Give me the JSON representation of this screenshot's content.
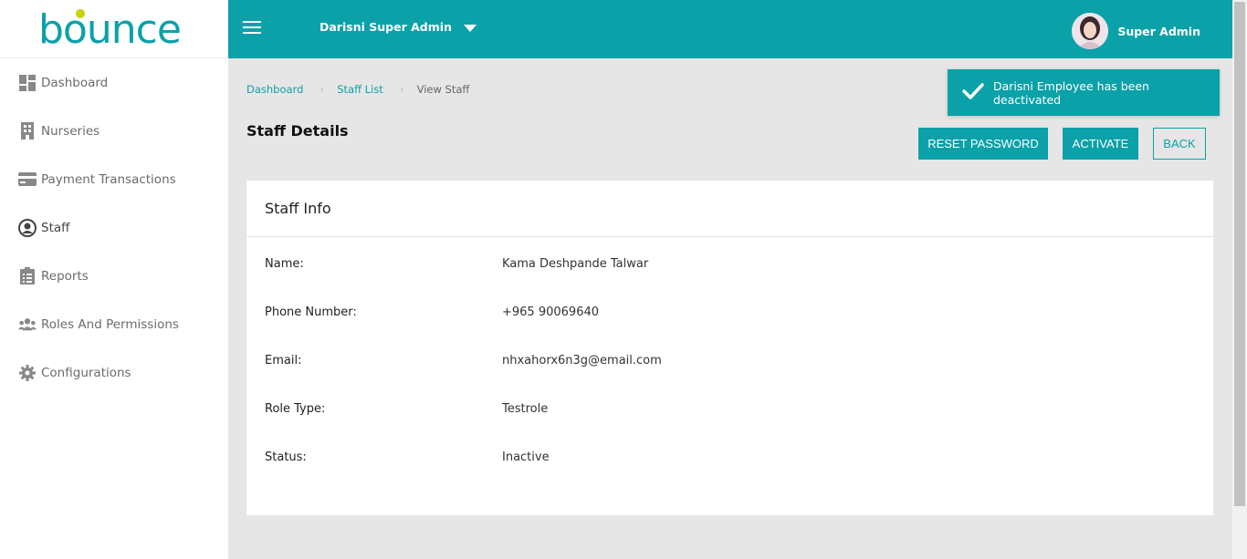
{
  "brand": {
    "logo": "bounce",
    "accent": "#0ba1a9"
  },
  "sidebar": {
    "items": [
      {
        "label": "Dashboard",
        "icon": "dashboard-icon"
      },
      {
        "label": "Nurseries",
        "icon": "building-icon"
      },
      {
        "label": "Payment Transactions",
        "icon": "credit-card-icon"
      },
      {
        "label": "Staff",
        "icon": "user-circle-icon"
      },
      {
        "label": "Reports",
        "icon": "clipboard-icon"
      },
      {
        "label": "Roles And Permissions",
        "icon": "users-icon"
      },
      {
        "label": "Configurations",
        "icon": "gear-icon"
      }
    ]
  },
  "topbar": {
    "org_selector": "Darisni Super Admin",
    "user_name": "Super Admin"
  },
  "breadcrumb": {
    "home": "Dashboard",
    "list": "Staff List",
    "current": "View Staff"
  },
  "page": {
    "title": "Staff Details",
    "buttons": {
      "reset_password": "RESET PASSWORD",
      "activate": "ACTIVATE",
      "back": "BACK"
    }
  },
  "card": {
    "title": "Staff Info",
    "fields": [
      {
        "label": "Name:",
        "value": "Kama Deshpande Talwar"
      },
      {
        "label": "Phone Number:",
        "value": "+965 90069640"
      },
      {
        "label": "Email:",
        "value": "nhxahorx6n3g@email.com"
      },
      {
        "label": "Role Type:",
        "value": "Testrole"
      },
      {
        "label": "Status:",
        "value": "Inactive"
      }
    ]
  },
  "toast": {
    "message": "Darisni Employee has been deactivated",
    "icon": "check-icon"
  }
}
